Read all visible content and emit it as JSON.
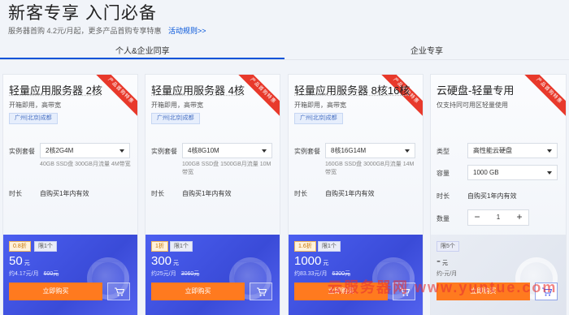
{
  "header": {
    "title": "新客专享 入门必备",
    "subtitle": "服务器首购 4.2元/月起，更多产品首购专享特惠",
    "rules_link": "活动规则>>"
  },
  "tabs": [
    {
      "label": "个人&企业同享",
      "active": true
    },
    {
      "label": "企业专享",
      "active": false
    }
  ],
  "colors": {
    "accent": "#0052d9",
    "buy": "#ff7a1f",
    "ribbon": "#e8392b",
    "panel": "#4b5ff0"
  },
  "cards": [
    {
      "ribbon": "产品首购特惠",
      "title": "轻量应用服务器 2核",
      "desc": "开箱即用，高带宽",
      "region": "广州|北京|成都",
      "spec_label": "实例套餐",
      "spec_value": "2核2G4M",
      "spec_note": "40GB SSD盘 300GB月流量 4M带宽",
      "duration_label": "时长",
      "duration_value": "自购买1年内有效",
      "discount": "0.8折",
      "limit": "限1个",
      "price": "50",
      "price_unit": "元",
      "monthly": "约4.17元/月",
      "original": "600元",
      "buy_label": "立即购买",
      "cart_icon": "cart-icon"
    },
    {
      "ribbon": "产品首购特惠",
      "title": "轻量应用服务器 4核",
      "desc": "开箱即用，高带宽",
      "region": "广州|北京|成都",
      "spec_label": "实例套餐",
      "spec_value": "4核8G10M",
      "spec_note": "100GB SSD盘 1500GB月流量 10M带宽",
      "duration_label": "时长",
      "duration_value": "自购买1年内有效",
      "discount": "1折",
      "limit": "限1个",
      "price": "300",
      "price_unit": "元",
      "monthly": "约25元/月",
      "original": "3060元",
      "buy_label": "立即购买",
      "cart_icon": "cart-icon"
    },
    {
      "ribbon": "产品首购特惠",
      "title": "轻量应用服务器 8核16核",
      "desc": "开箱即用，高带宽",
      "region": "广州|北京|成都",
      "spec_label": "实例套餐",
      "spec_value": "8核16G14M",
      "spec_note": "160GB SSD盘 3000GB月流量 14M带宽",
      "duration_label": "时长",
      "duration_value": "自购买1年内有效",
      "discount": "1.6折",
      "limit": "限1个",
      "price": "1000",
      "price_unit": "元",
      "monthly": "约83.33元/月",
      "original": "6300元",
      "buy_label": "立即购买",
      "cart_icon": "cart-icon"
    }
  ],
  "disk_card": {
    "ribbon": "产品首购特惠",
    "title": "云硬盘-轻量专用",
    "desc": "仅支持同可用区轻量使用",
    "type_label": "类型",
    "type_value": "高性能云硬盘",
    "capacity_label": "容量",
    "capacity_value": "1000 GB",
    "duration_label": "时长",
    "duration_value": "自购买1年内有效",
    "qty_label": "数量",
    "qty_value": "1",
    "minus": "−",
    "plus": "+",
    "limit": "限5个",
    "price": "-",
    "price_unit": "元",
    "monthly": "约-元/月",
    "buy_label": "立即购买",
    "cart_icon": "cart-icon"
  },
  "watermark": "云服务器网 www.yuntue.com"
}
